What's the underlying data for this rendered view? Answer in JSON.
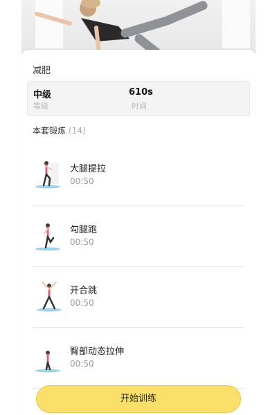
{
  "workout": {
    "title": "减肥",
    "level_value": "中级",
    "level_label": "等级",
    "time_value": "610s",
    "time_label": "时间"
  },
  "exercises_section": {
    "title": "本套锻炼",
    "count": "(14)"
  },
  "exercises": [
    {
      "name": "大腿提拉",
      "duration": "00:50"
    },
    {
      "name": "勾腿跑",
      "duration": "00:50"
    },
    {
      "name": "开合跳",
      "duration": "00:50"
    },
    {
      "name": "臀部动态拉伸",
      "duration": "00:50"
    }
  ],
  "start_button": {
    "label": "开始训练"
  },
  "colors": {
    "accent": "#fadf6a",
    "stats_bg": "#f4f4f4",
    "divider": "#e7e7e7",
    "mat": "#9fd1ea"
  }
}
